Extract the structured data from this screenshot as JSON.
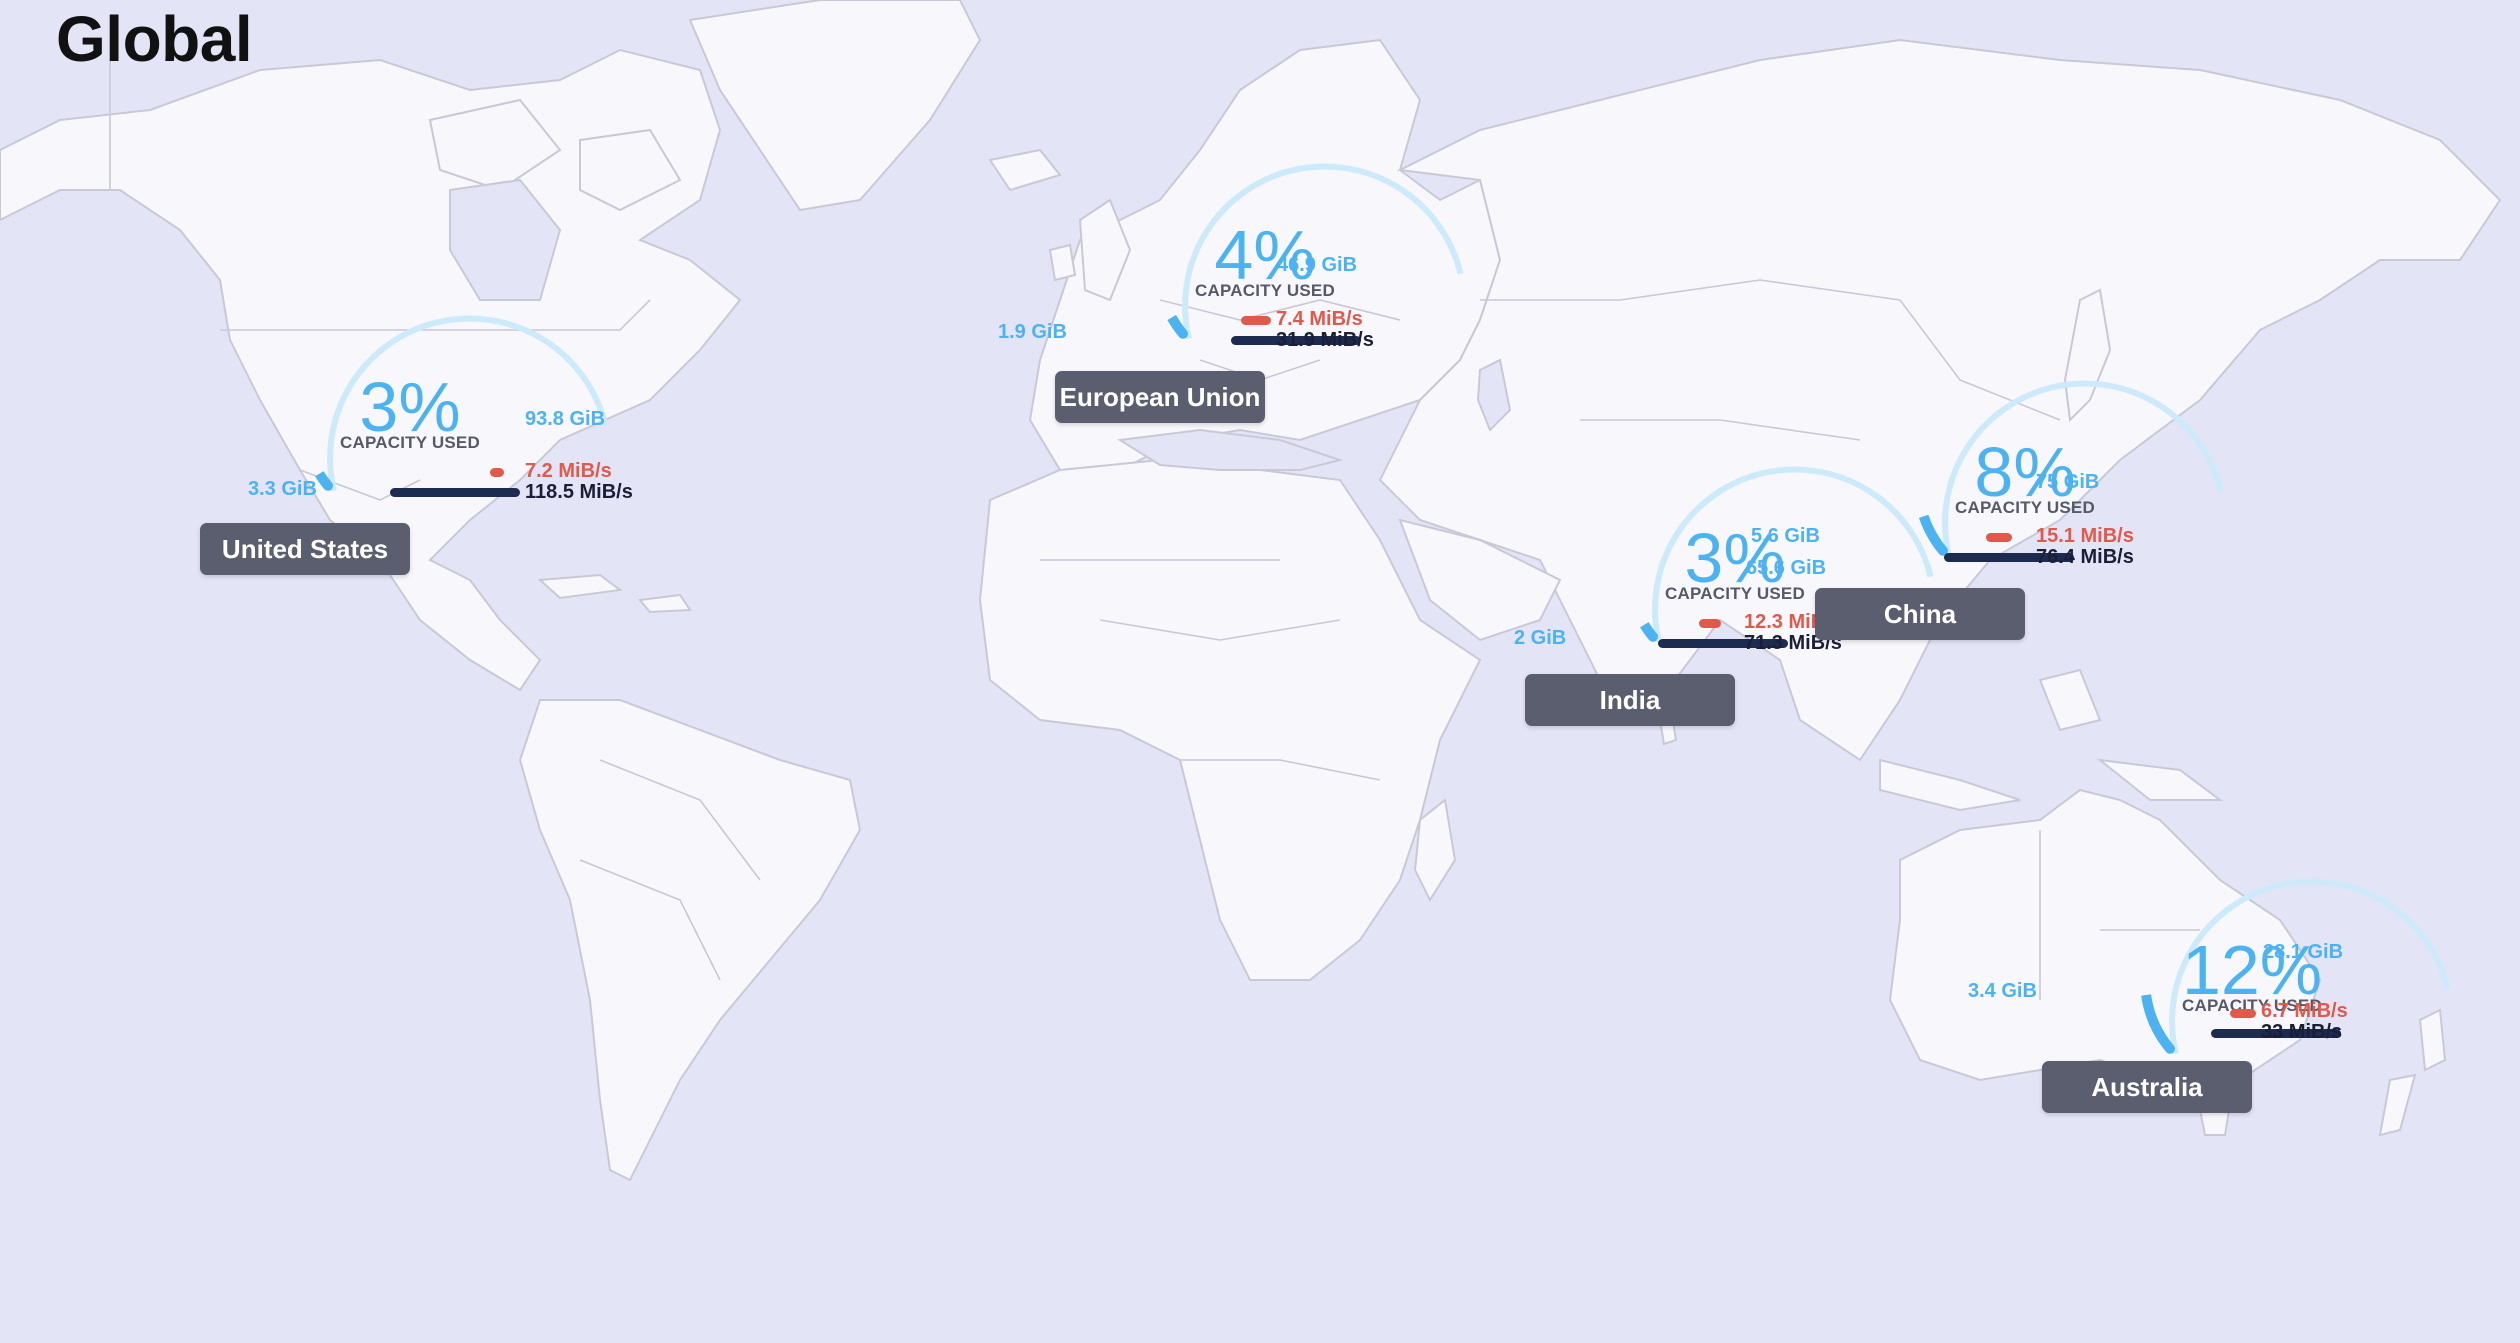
{
  "page": {
    "title": "Global"
  },
  "labels": {
    "capacity_used": "CAPACITY USED"
  },
  "colors": {
    "sea": "#e4e4f7",
    "land": "#f7f7fc",
    "gauge": "#4db3f0",
    "gauge_track": "#cdeafb",
    "rate_red": "#e05a4b",
    "rate_dark": "#1c2b4f",
    "badge_bg": "#5b5e6e"
  },
  "regions": [
    {
      "key": "us",
      "name": "United States",
      "percent": "3%",
      "used": "3.3 GiB",
      "capacity": "93.8 GiB",
      "rate_red": "7.2 MiB/s",
      "rate_dark": "118.5 MiB/s",
      "used_fraction": 0.03,
      "red_fraction": 0.06,
      "dark_fraction": 1.0
    },
    {
      "key": "eu",
      "name": "European Union",
      "percent": "4%",
      "used": "1.9 GiB",
      "capacity": "46.9 GiB",
      "rate_red": "7.4 MiB/s",
      "rate_dark": "31.9 MiB/s",
      "used_fraction": 0.04,
      "red_fraction": 0.23,
      "dark_fraction": 1.0
    },
    {
      "key": "in",
      "name": "India",
      "percent": "3%",
      "used": "2 GiB",
      "capacity": "65.6 GiB",
      "rate_red": "12.3 MiB/s",
      "rate_dark": "71.3 MiB/s",
      "used_fraction": 0.03,
      "red_fraction": 0.17,
      "dark_fraction": 1.0
    },
    {
      "key": "cn",
      "name": "China",
      "percent": "8%",
      "used": "5.6 GiB",
      "capacity": "75 GiB",
      "rate_red": "15.1 MiB/s",
      "rate_dark": "76.4 MiB/s",
      "used_fraction": 0.08,
      "red_fraction": 0.2,
      "dark_fraction": 1.0
    },
    {
      "key": "au",
      "name": "Australia",
      "percent": "12%",
      "used": "3.4 GiB",
      "capacity": "28.1 GiB",
      "rate_red": "6.7 MiB/s",
      "rate_dark": "33 MiB/s",
      "used_fraction": 0.12,
      "red_fraction": 0.2,
      "dark_fraction": 1.0
    }
  ]
}
